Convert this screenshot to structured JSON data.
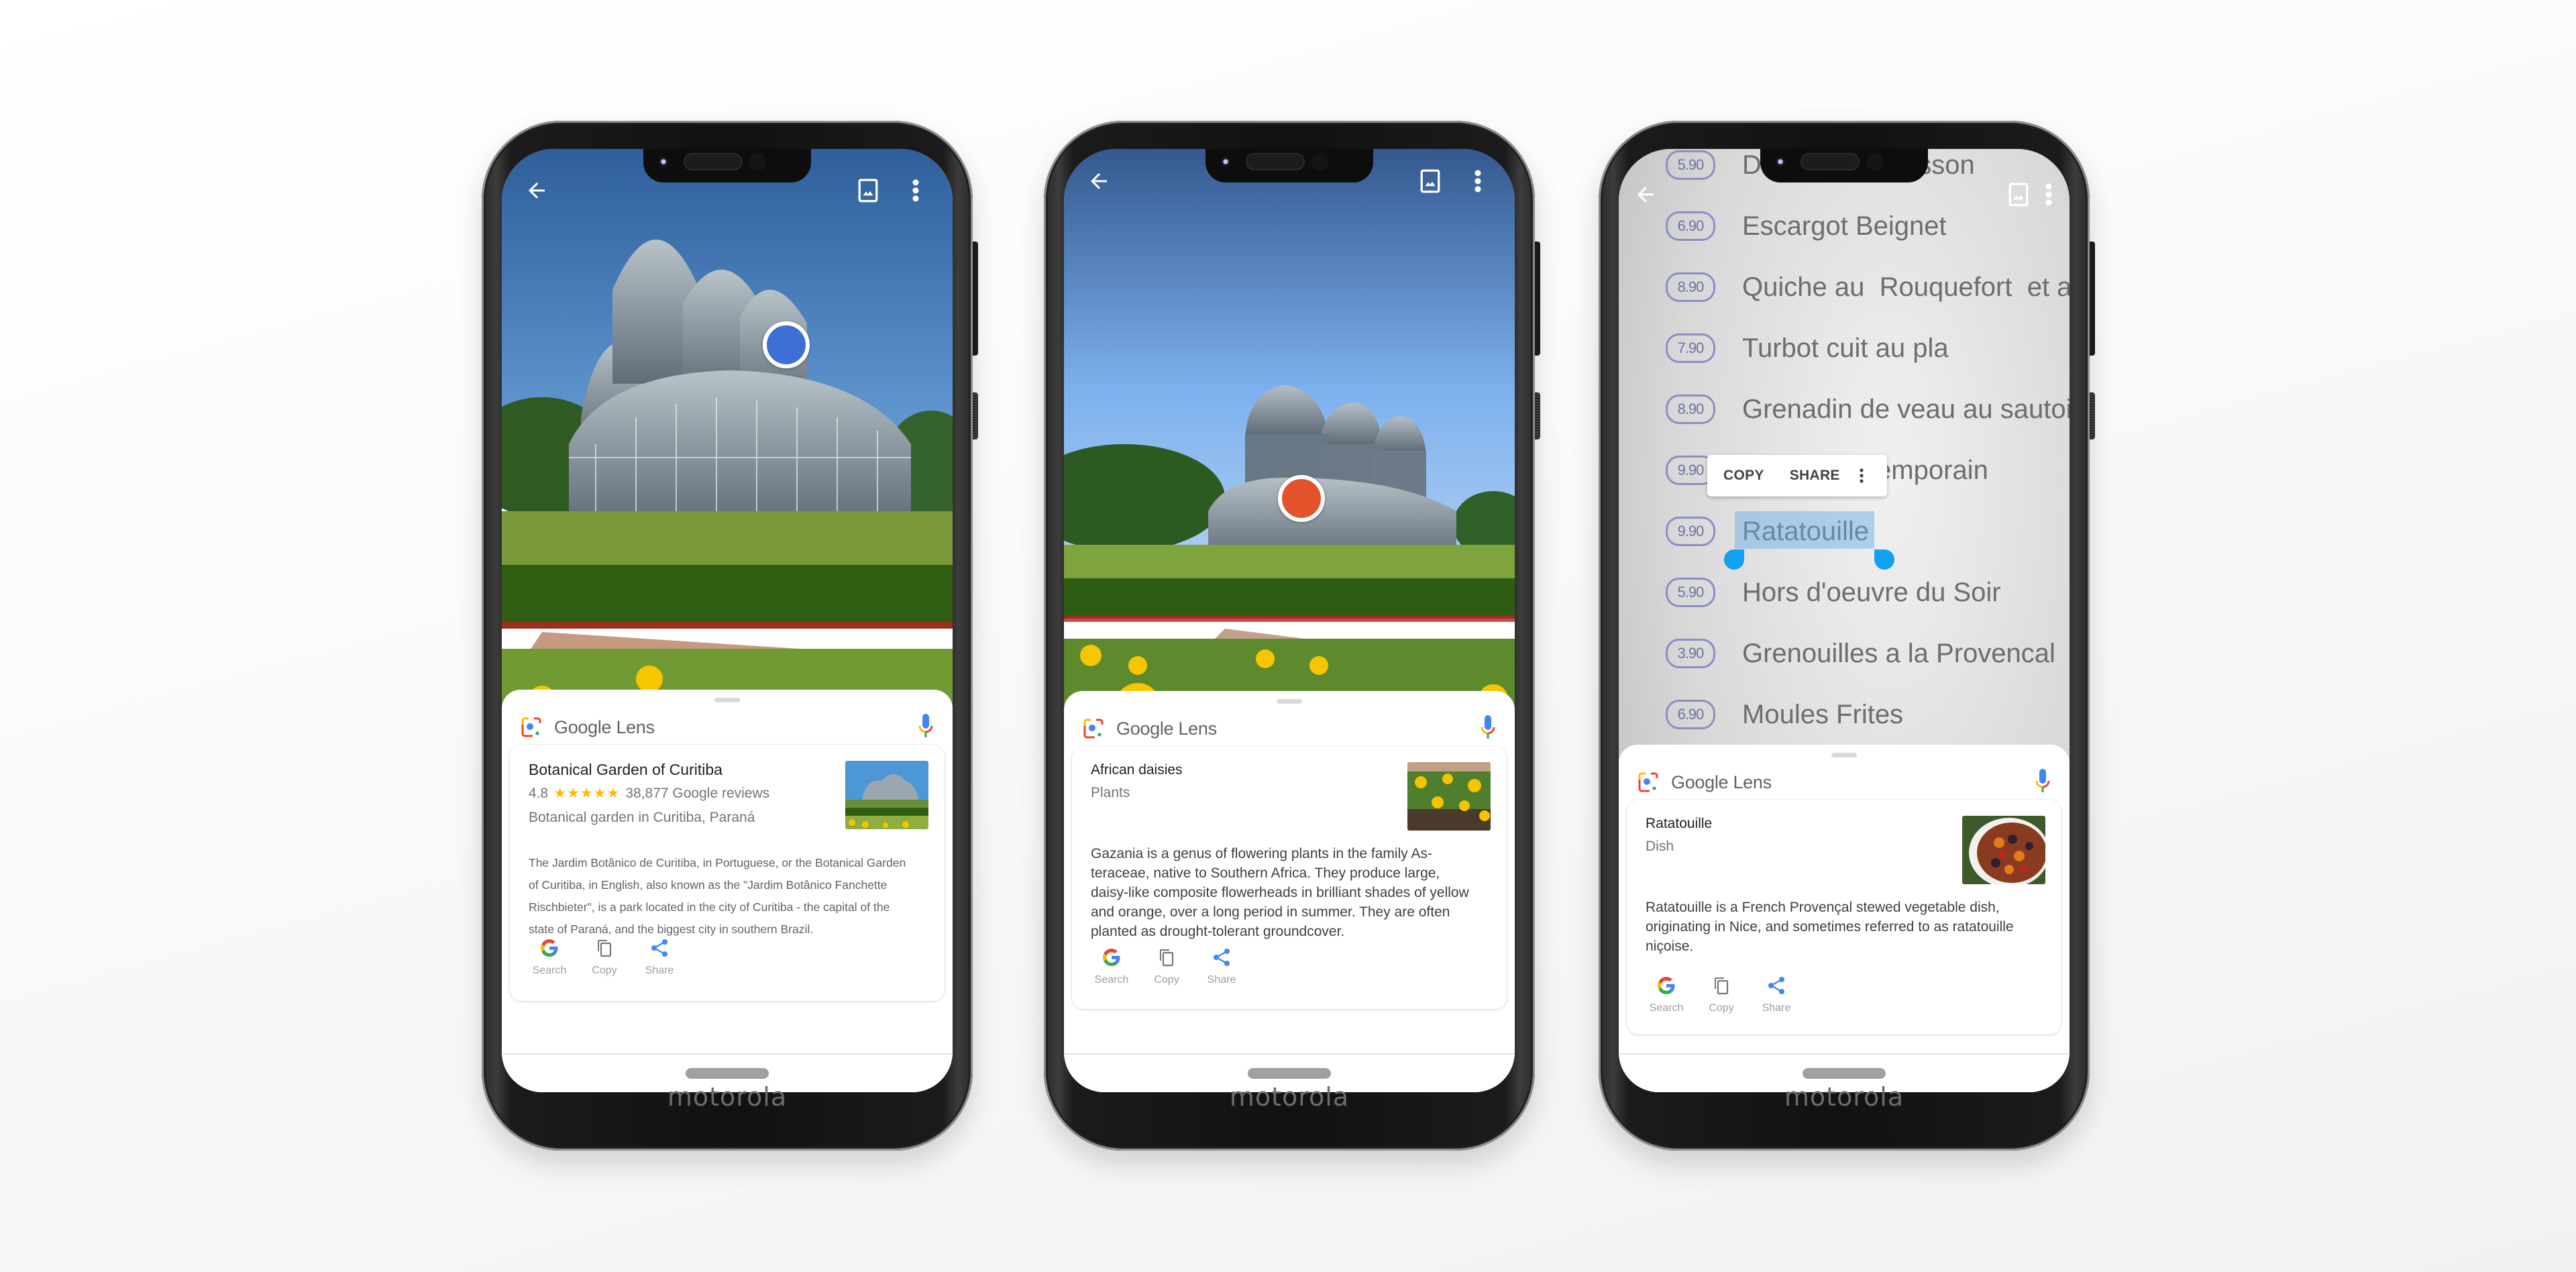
{
  "brand_label": "motorola",
  "colors": {
    "focus_blue": "#3d6fd6",
    "focus_orange": "#e2532b",
    "selection_handle": "#12a0f0",
    "star": "#fbbc04"
  },
  "phones": [
    {
      "topbar": {
        "back_icon": "arrow-back-icon",
        "gallery_icon": "gallery-icon",
        "more_icon": "more-vert-icon"
      },
      "scene": "botanical-garden-greenhouse",
      "focus_dot_color": "#3d6fd6",
      "lens": {
        "app_name_google": "Google",
        "app_name_lens": "Lens",
        "mic_icon": "mic-icon"
      },
      "result": {
        "title": "Botanical Garden of Curitiba",
        "rating": "4.8",
        "stars": "★★★★★",
        "reviews": "38,877 Google reviews",
        "subtitle": "Botanical garden in Curitiba, Paraná",
        "description": "The Jardim Botânico de Curitiba, in Portuguese, or the Botanical Garden of Curitiba, in English, also known as the \"Jardim Botânico Fanchette Rischbieter\", is a park located in the city of Curitiba - the capital of the state of Paraná, and the biggest city in southern Brazil.",
        "actions": [
          {
            "label": "Search",
            "icon": "google-g-icon"
          },
          {
            "label": "Copy",
            "icon": "copy-icon"
          },
          {
            "label": "Share",
            "icon": "share-icon"
          }
        ]
      }
    },
    {
      "topbar": {
        "back_icon": "arrow-back-icon",
        "gallery_icon": "gallery-icon",
        "more_icon": "more-vert-icon"
      },
      "scene": "flower-bed-greenhouse",
      "focus_dot_color": "#e2532b",
      "lens": {
        "app_name_google": "Google",
        "app_name_lens": "Lens",
        "mic_icon": "mic-icon"
      },
      "result": {
        "title": "African daisies",
        "subtitle": "Plants",
        "description": "Gazania is a genus of flowering plants in the family As-teraceae, native to Southern Africa. They produce large, daisy-like composite flowerheads in brilliant shades of yellow and orange, over a long period in summer. They are often planted as drought-tolerant groundcover.",
        "actions": [
          {
            "label": "Search",
            "icon": "google-g-icon"
          },
          {
            "label": "Copy",
            "icon": "copy-icon"
          },
          {
            "label": "Share",
            "icon": "share-icon"
          }
        ]
      }
    },
    {
      "topbar": {
        "back_icon": "arrow-back-icon",
        "gallery_icon": "gallery-icon",
        "more_icon": "more-vert-icon"
      },
      "scene": "printed-menu",
      "menu_items": [
        {
          "price": "5.90",
          "dish": "Do          e, cresson"
        },
        {
          "price": "6.90",
          "dish": "Escargot Beignet"
        },
        {
          "price": "8.90",
          "dish": "Quiche au  Rouquefort  et a"
        },
        {
          "price": "7.90",
          "dish": "Turbot cuit au pla"
        },
        {
          "price": "8.90",
          "dish": "Grenadin de veau au sautoi"
        },
        {
          "price": "9.90",
          "dish": "               ntemporain"
        },
        {
          "price": "9.90",
          "dish": "Ratatouille"
        },
        {
          "price": "5.90",
          "dish": "Hors d'oeuvre du Soir"
        },
        {
          "price": "3.90",
          "dish": "Grenouilles a la Provencal"
        },
        {
          "price": "6.90",
          "dish": "Moules Frites"
        }
      ],
      "selected_text": "Ratatouille",
      "selection_toolbar": {
        "copy": "COPY",
        "share": "SHARE",
        "more_icon": "more-vert-icon"
      },
      "lens": {
        "app_name_google": "Google",
        "app_name_lens": "Lens",
        "mic_icon": "mic-icon"
      },
      "result": {
        "title": "Ratatouille",
        "subtitle": "Dish",
        "description": "Ratatouille is a French Provençal stewed vegetable dish, originating in Nice, and sometimes referred to as ratatouille niçoise.",
        "actions": [
          {
            "label": "Search",
            "icon": "google-g-icon"
          },
          {
            "label": "Copy",
            "icon": "copy-icon"
          },
          {
            "label": "Share",
            "icon": "share-icon"
          }
        ]
      }
    }
  ]
}
